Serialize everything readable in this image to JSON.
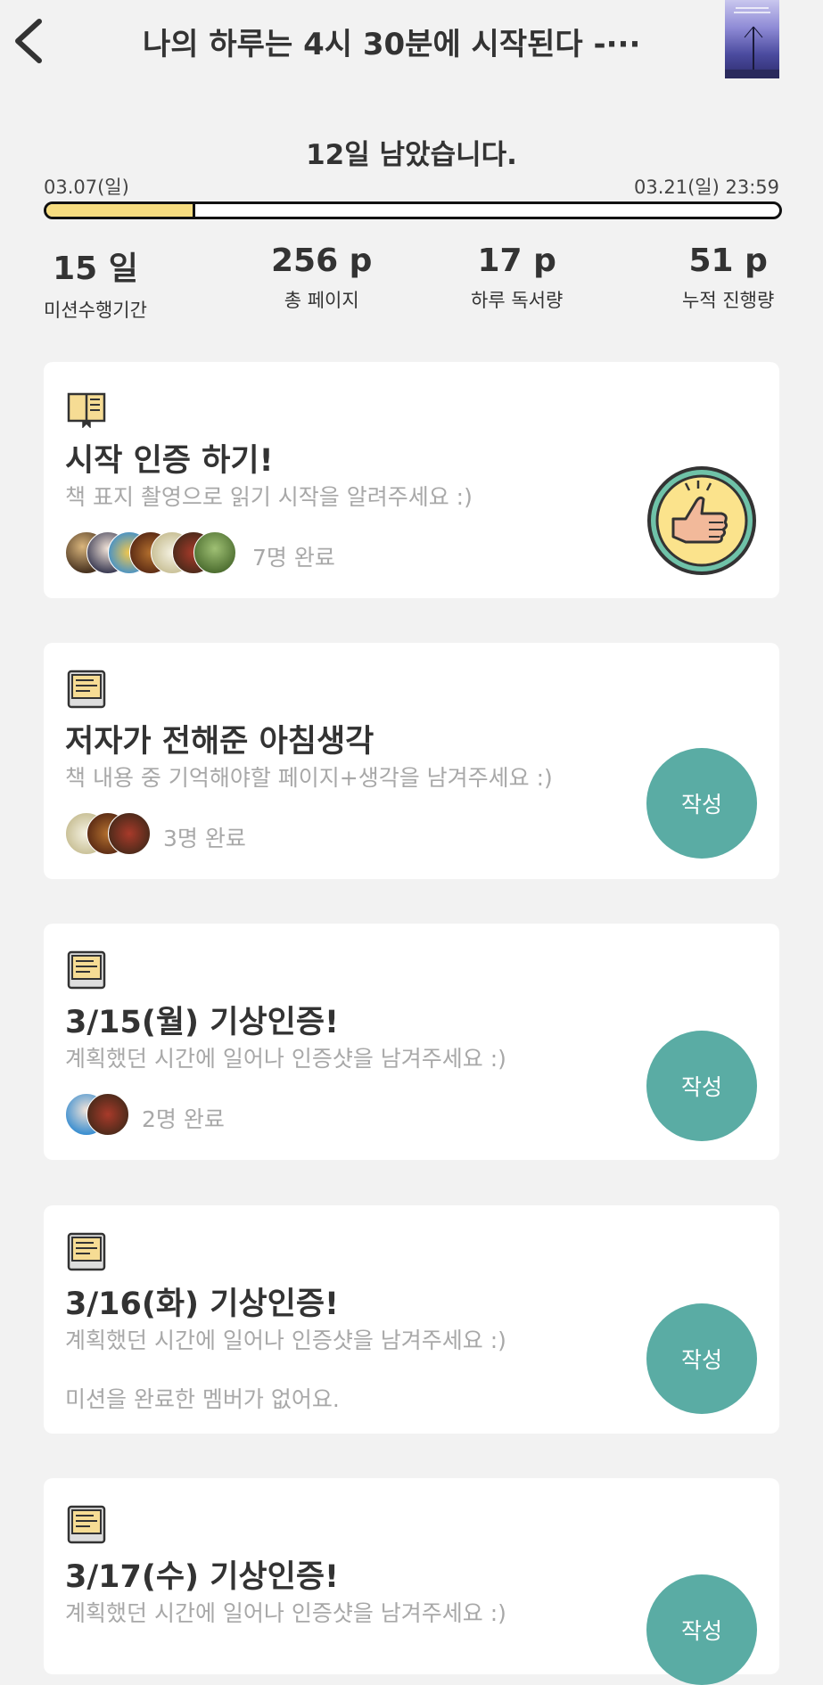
{
  "header": {
    "title": "나의 하루는 4시 30분에 시작된다 -···"
  },
  "countdown": "12일 남았습니다.",
  "period": {
    "start": "03.07(일)",
    "end": "03.21(일) 23:59",
    "progress": 0.2
  },
  "stats": [
    {
      "value": "15 일",
      "label": "미션수행기간"
    },
    {
      "value": "256 p",
      "label": "총 페이지"
    },
    {
      "value": "17 p",
      "label": "하루 독서량"
    },
    {
      "value": "51 p",
      "label": "누적 진행량"
    }
  ],
  "missions": [
    {
      "title": "시작 인증 하기!",
      "desc": "책 표지 촬영으로 읽기 시작을 알려주세요 :)",
      "completed": "7명 완료",
      "status": "done"
    },
    {
      "title": "저자가 전해준 아침생각",
      "desc": "책 내용 중 기억해야할 페이지+생각을 남겨주세요 :)",
      "completed": "3명 완료",
      "button": "작성"
    },
    {
      "title": "3/15(월) 기상인증!",
      "desc": "계획했던 시간에 일어나 인증샷을 남겨주세요 :)",
      "completed": "2명 완료",
      "button": "작성"
    },
    {
      "title": "3/16(화) 기상인증!",
      "desc": "계획했던 시간에 일어나 인증샷을 남겨주세요 :)",
      "empty": "미션을 완료한 멤버가 없어요.",
      "button": "작성"
    },
    {
      "title": "3/17(수) 기상인증!",
      "desc": "계획했던 시간에 일어나 인증샷을 남겨주세요 :)",
      "button": "작성"
    }
  ],
  "colors": {
    "accent": "#5aaca4",
    "progress_fill": "#f7dd80",
    "background": "#f2f2f2",
    "muted_text": "#a8a8a8"
  }
}
